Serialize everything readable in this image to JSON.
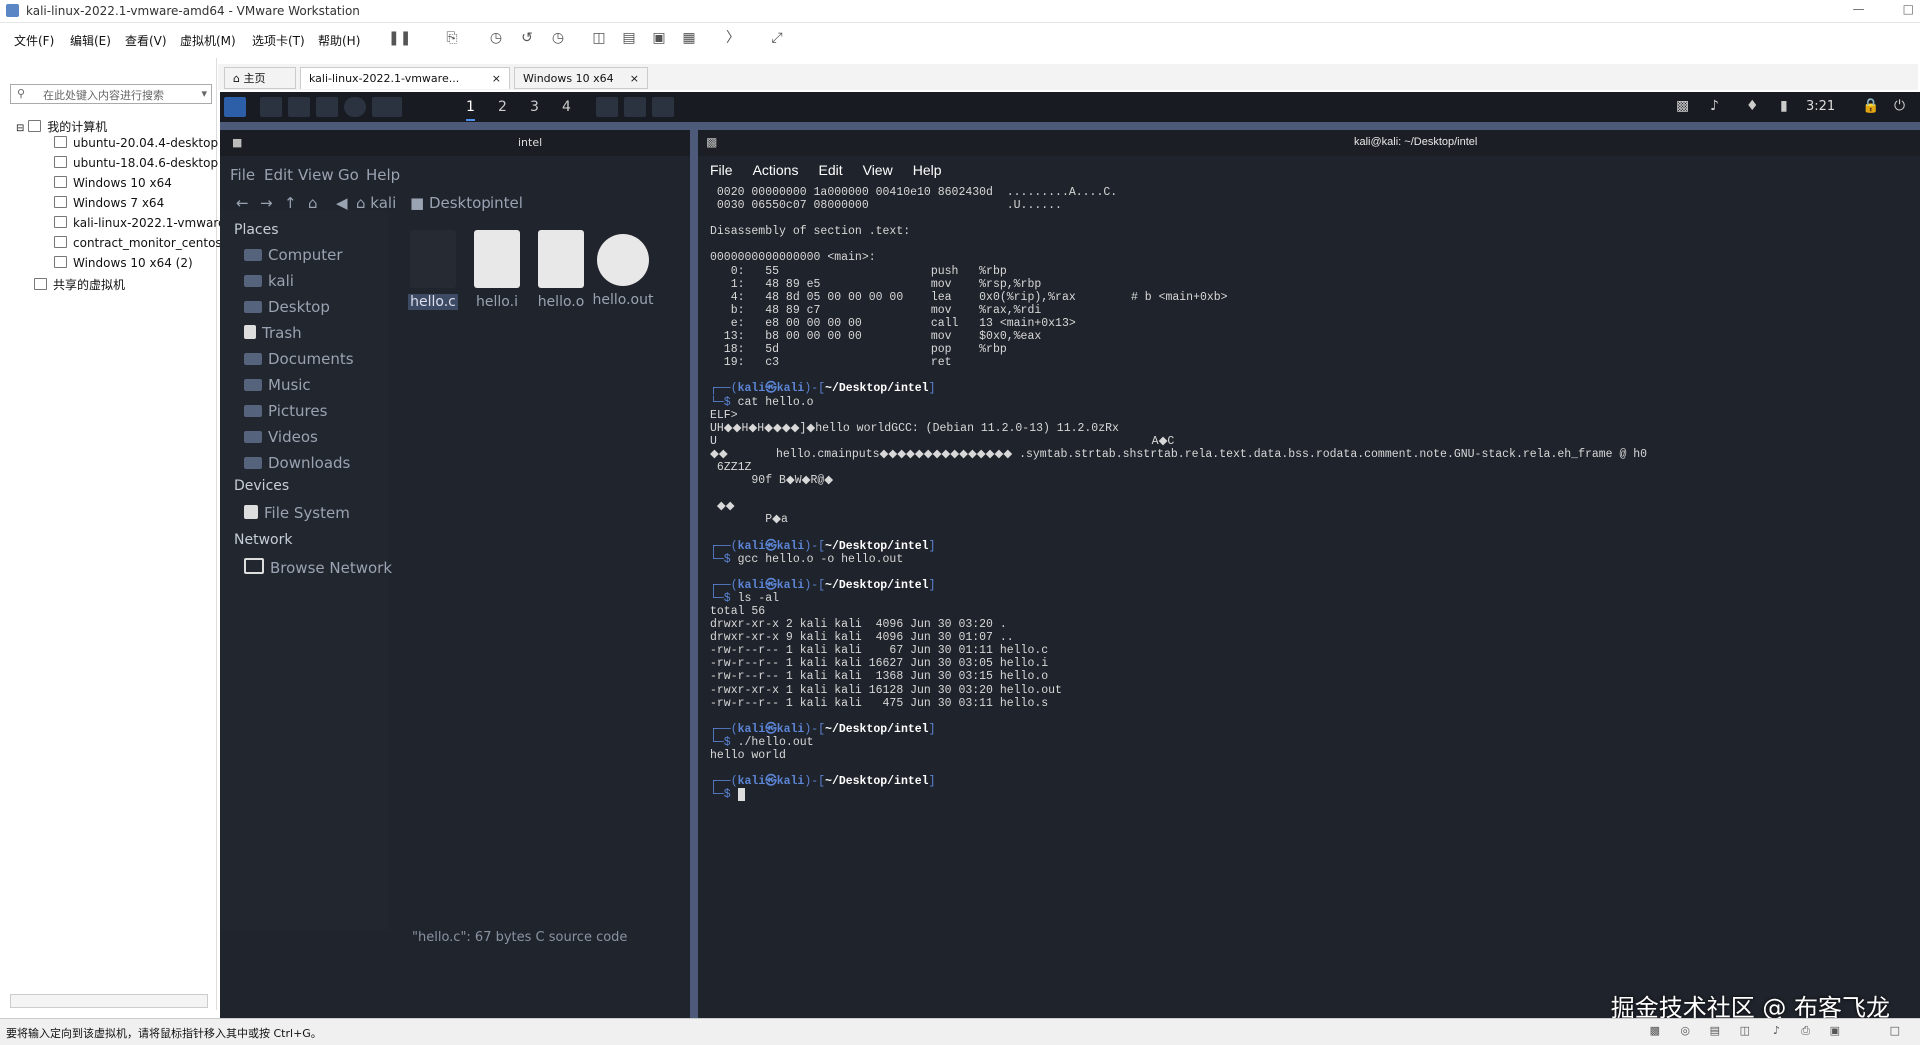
{
  "window": {
    "title": "kali-linux-2022.1-vmware-amd64 - VMware Workstation"
  },
  "menubar": {
    "items": [
      "文件(F)",
      "编辑(E)",
      "查看(V)",
      "虚拟机(M)",
      "选项卡(T)",
      "帮助(H)"
    ]
  },
  "library": {
    "search_placeholder": "在此处键入内容进行搜索",
    "root": "我的计算机",
    "vms": [
      "ubuntu-20.04.4-desktop",
      "ubuntu-18.04.6-desktop",
      "Windows 10 x64",
      "Windows 7 x64",
      "kali-linux-2022.1-vmware",
      "contract_monitor_centos",
      "Windows 10 x64 (2)"
    ],
    "shared": "共享的虚拟机"
  },
  "tabs": [
    {
      "label": "主页"
    },
    {
      "label": "kali-linux-2022.1-vmware..."
    },
    {
      "label": "Windows 10 x64"
    }
  ],
  "guest_panel": {
    "workspaces": [
      "1",
      "2",
      "3",
      "4"
    ],
    "clock": "3:21"
  },
  "file_manager": {
    "title": "intel",
    "menu": [
      "File",
      "Edit",
      "View",
      "Go",
      "Help"
    ],
    "breadcrumb": [
      "kali",
      "Desktop",
      "intel"
    ],
    "places_header": "Places",
    "places": [
      "Computer",
      "kali",
      "Desktop",
      "Trash",
      "Documents",
      "Music",
      "Pictures",
      "Videos",
      "Downloads"
    ],
    "devices_header": "Devices",
    "devices": [
      "File System"
    ],
    "network_header": "Network",
    "network": [
      "Browse Network"
    ],
    "files": [
      "hello.c",
      "hello.i",
      "hello.o",
      "hello.out"
    ],
    "status": "\"hello.c\": 67 bytes C source code"
  },
  "terminal": {
    "title": "kali@kali: ~/Desktop/intel",
    "menu": [
      "File",
      "Actions",
      "Edit",
      "View",
      "Help"
    ],
    "user": "kali",
    "host": "kali",
    "cwd": "~/Desktop/intel",
    "hexdump": [
      " 0020 00000000 1a000000 00410e10 8602430d  .........A....C.",
      " 0030 06550c07 08000000                    .U......"
    ],
    "section_header": "Disassembly of section .text:",
    "func_header": "0000000000000000 <main>:",
    "disasm": [
      "   0:   55                      push   %rbp",
      "   1:   48 89 e5                mov    %rsp,%rbp",
      "   4:   48 8d 05 00 00 00 00    lea    0x0(%rip),%rax        # b <main+0xb>",
      "   b:   48 89 c7                mov    %rax,%rdi",
      "   e:   e8 00 00 00 00          call   13 <main+0x13>",
      "  13:   b8 00 00 00 00          mov    $0x0,%eax",
      "  18:   5d                      pop    %rbp",
      "  19:   c3                      ret"
    ],
    "cmd1": "cat hello.o",
    "cat_output": [
      "ELF>",
      "UH◆◆H◆H◆◆◆◆]◆hello worldGCC: (Debian 11.2.0-13) 11.2.0zRx",
      "U                                                               A◆C",
      "◆◆       hello.cmainputs◆◆◆◆◆◆◆◆◆◆◆◆◆◆◆ .symtab.strtab.shstrtab.rela.text.data.bss.rodata.comment.note.GNU-stack.rela.eh_frame @ h0",
      " 6ZZ1Z",
      "      90f B◆W◆R@◆",
      "",
      " ◆◆",
      "        P◆a"
    ],
    "cmd2": "gcc hello.o -o hello.out",
    "cmd3": "ls -al",
    "ls_total": "total 56",
    "ls_lines": [
      "drwxr-xr-x 2 kali kali  4096 Jun 30 03:20 .",
      "drwxr-xr-x 9 kali kali  4096 Jun 30 01:07 ..",
      "-rw-r--r-- 1 kali kali    67 Jun 30 01:11 hello.c",
      "-rw-r--r-- 1 kali kali 16627 Jun 30 03:05 hello.i",
      "-rw-r--r-- 1 kali kali  1368 Jun 30 03:15 hello.o",
      "-rwxr-xr-x 1 kali kali 16128 Jun 30 03:20 hello.out",
      "-rw-r--r-- 1 kali kali   475 Jun 30 03:11 hello.s"
    ],
    "cmd4": "./hello.out",
    "program_output": "hello world"
  },
  "statusbar": {
    "text": "要将输入定向到该虚拟机，请将鼠标指针移入其中或按 Ctrl+G。"
  },
  "watermark": "掘金技术社区 @ 布客飞龙"
}
